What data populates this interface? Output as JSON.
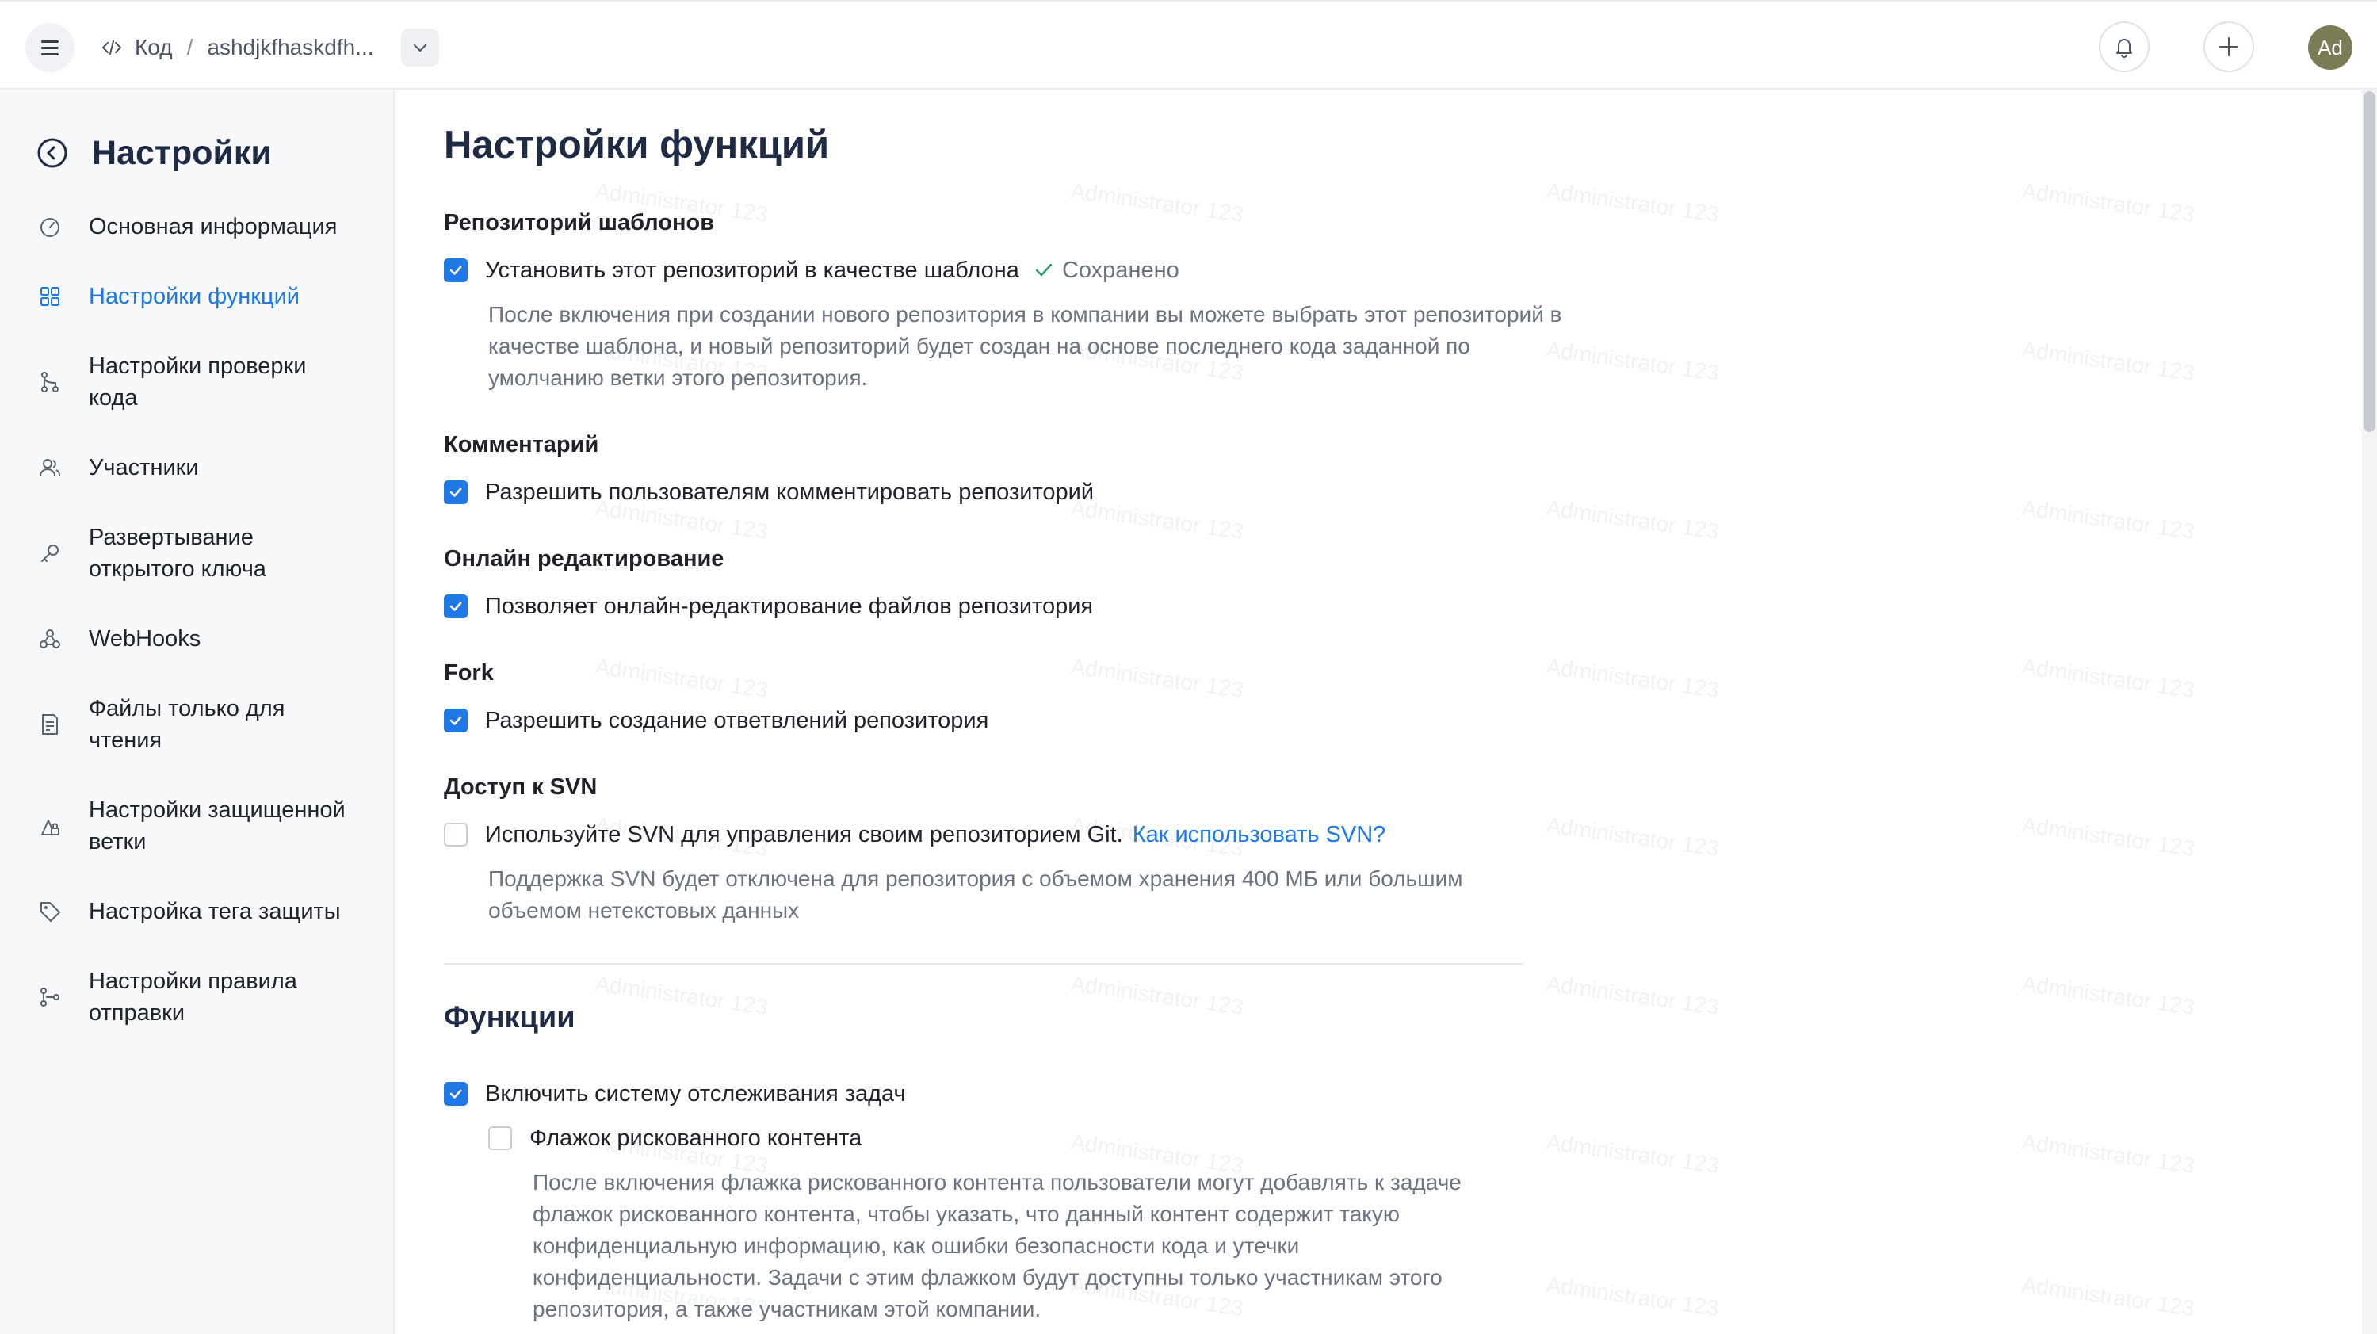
{
  "topbar": {
    "breadcrumb_root": "Код",
    "breadcrumb_sep": "/",
    "repo_name": "ashdjkfhaskdfh...",
    "avatar_initials": "Ad"
  },
  "sidebar": {
    "title": "Настройки",
    "items": [
      {
        "label": "Основная информация",
        "icon": "speedometer-icon"
      },
      {
        "label": "Настройки функций",
        "icon": "grid-icon",
        "active": true
      },
      {
        "label": "Настройки проверки кода",
        "icon": "branch-merge-icon"
      },
      {
        "label": "Участники",
        "icon": "users-icon"
      },
      {
        "label": "Развертывание открытого ключа",
        "icon": "key-icon"
      },
      {
        "label": "WebHooks",
        "icon": "webhook-icon"
      },
      {
        "label": "Файлы только для чтения",
        "icon": "readonly-file-icon"
      },
      {
        "label": "Настройки защищенной ветки",
        "icon": "lock-branch-icon"
      },
      {
        "label": "Настройка тега защиты",
        "icon": "tag-icon"
      },
      {
        "label": "Настройки правила отправки",
        "icon": "push-rule-icon"
      }
    ]
  },
  "main": {
    "page_title": "Настройки функций",
    "template": {
      "title": "Репозиторий шаблонов",
      "checkbox_label": "Установить этот репозиторий в качестве шаблона",
      "checked": true,
      "saved_text": "Сохранено",
      "description": "После включения при создании нового репозитория в компании вы можете выбрать этот репозиторий в качестве шаблона, и новый репозиторий будет создан на основе последнего кода заданной по умолчанию ветки этого репозитория."
    },
    "comment": {
      "title": "Комментарий",
      "checkbox_label": "Разрешить пользователям комментировать репозиторий",
      "checked": true
    },
    "online_edit": {
      "title": "Онлайн редактирование",
      "checkbox_label": "Позволяет онлайн-редактирование файлов репозитория",
      "checked": true
    },
    "fork": {
      "title": "Fork",
      "checkbox_label": "Разрешить создание ответвлений репозитория",
      "checked": true
    },
    "svn": {
      "title": "Доступ к SVN",
      "checkbox_label": "Используйте SVN для управления своим репозиторием Git.",
      "checked": false,
      "link_text": "Как использовать SVN?",
      "description": "Поддержка SVN будет отключена для репозитория с объемом хранения 400 МБ или большим объемом нетекстовых данных"
    },
    "functions": {
      "title": "Функции",
      "issue_tracking_label": "Включить систему отслеживания задач",
      "issue_tracking_checked": true,
      "risky_label": "Флажок рискованного контента",
      "risky_checked": false,
      "risky_description": "После включения флажка рискованного контента пользователи могут добавлять к задаче флажок рискованного контента, чтобы указать, что данный контент содержит такую конфиденциальную информацию, как ошибки безопасности кода и утечки конфиденциальности. Задачи с этим флажком будут доступны только участникам этого репозитория, а также участникам этой компании."
    }
  },
  "watermark_text": "Administrator 123",
  "colors": {
    "accent": "#1e78e6",
    "title": "#1f2a44",
    "muted": "#6b7280",
    "sidebar_bg": "#f7f8fa"
  }
}
